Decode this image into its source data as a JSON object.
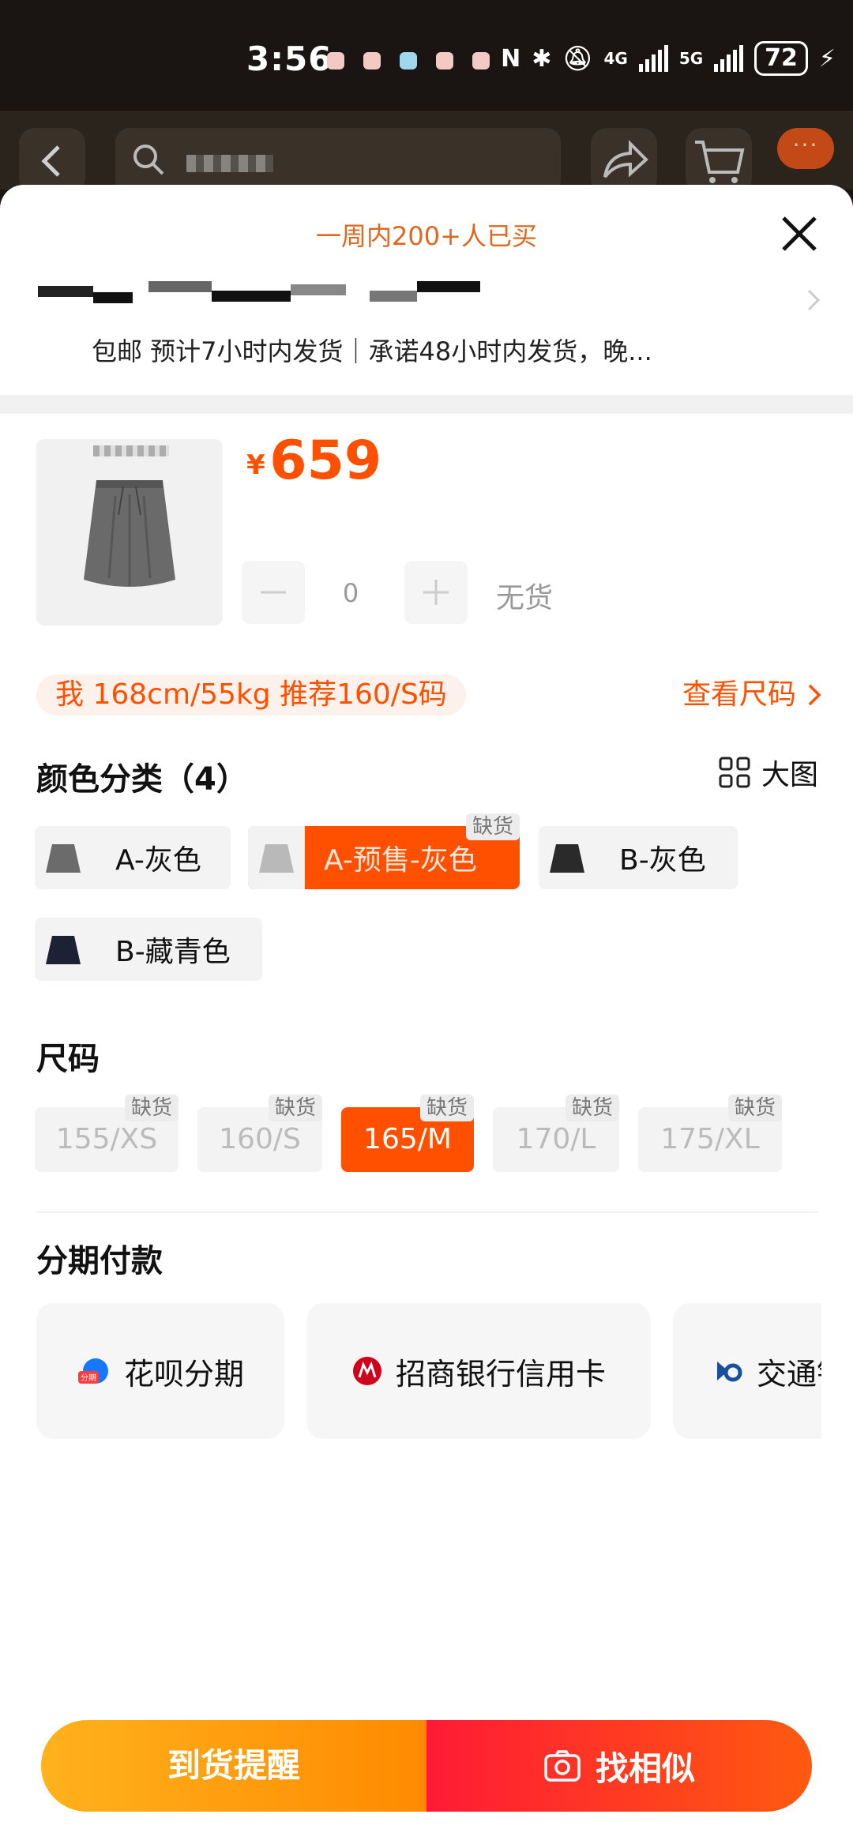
{
  "status_bar": {
    "time": "3:56",
    "net_4g": "4G",
    "net_5g": "5G",
    "battery": "72"
  },
  "header": {
    "more_label": "···"
  },
  "sheet": {
    "sold_banner": "一周内200+人已买",
    "delivery_text": "包邮 预计7小时内发货｜承诺48小时内发货，晚...",
    "price_symbol": "¥",
    "price": "659",
    "quantity": "0",
    "stock_status": "无货",
    "size_recommendation": "我 168cm/55kg 推荐160/S码",
    "size_chart_link": "查看尺码"
  },
  "color_section": {
    "title": "颜色分类（4）",
    "big_image_label": "大图",
    "options": [
      {
        "label": "A-灰色",
        "selected": false,
        "out_of_stock": false,
        "swatch": "#6b6b6b"
      },
      {
        "label": "A-预售-灰色",
        "selected": true,
        "out_of_stock": true,
        "swatch": "#b9b9b9"
      },
      {
        "label": "B-灰色",
        "selected": false,
        "out_of_stock": false,
        "swatch": "#2a2a2a"
      },
      {
        "label": "B-藏青色",
        "selected": false,
        "out_of_stock": false,
        "swatch": "#1c2233"
      }
    ],
    "oos_tag": "缺货"
  },
  "size_section": {
    "title": "尺码",
    "options": [
      {
        "label": "155/XS",
        "selected": false,
        "oos": "缺货"
      },
      {
        "label": "160/S",
        "selected": false,
        "oos": "缺货"
      },
      {
        "label": "165/M",
        "selected": true,
        "oos": "缺货"
      },
      {
        "label": "170/L",
        "selected": false,
        "oos": "缺货"
      },
      {
        "label": "175/XL",
        "selected": false,
        "oos": "缺货"
      }
    ]
  },
  "installment": {
    "title": "分期付款",
    "huabei_badge": "分期",
    "options": [
      {
        "label": "花呗分期"
      },
      {
        "label": "招商银行信用卡"
      },
      {
        "label": "交通银行"
      }
    ]
  },
  "actions": {
    "notify_label": "到货提醒",
    "find_similar_label": "找相似"
  },
  "colors": {
    "accent": "#ff5000",
    "banner_text": "#e2661d"
  }
}
